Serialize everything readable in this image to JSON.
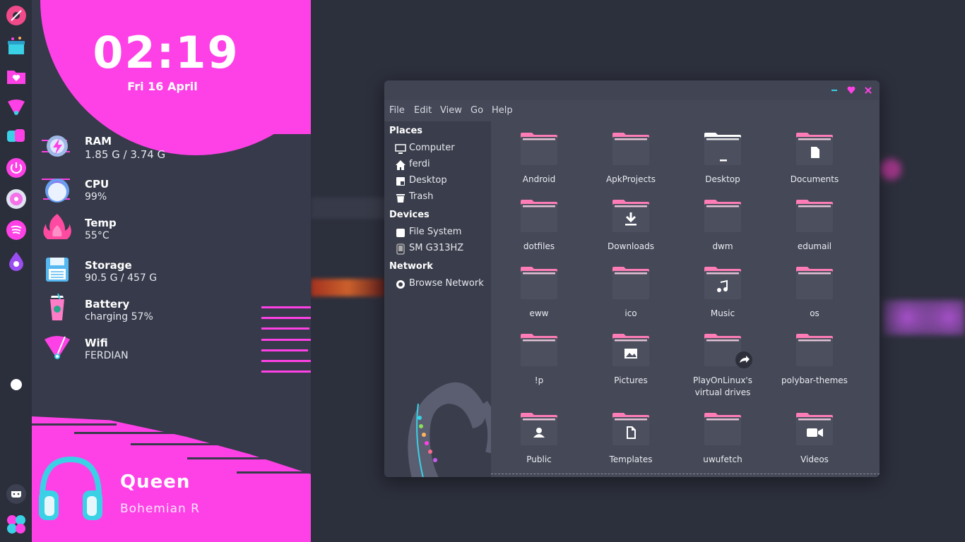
{
  "clock": {
    "time": "02:19",
    "date": "Fri 16 April"
  },
  "stats": [
    {
      "id": "ram",
      "label": "RAM",
      "value": "1.85 G / 3.74 G",
      "icon": "lightning-gear-icon"
    },
    {
      "id": "cpu",
      "label": "CPU",
      "value": "99%",
      "icon": "cpu-character-icon"
    },
    {
      "id": "temp",
      "label": "Temp",
      "value": "55°C",
      "icon": "flame-icon"
    },
    {
      "id": "storage",
      "label": "Storage",
      "value": "90.5 G / 457 G",
      "icon": "floppy-disk-icon"
    },
    {
      "id": "battery",
      "label": "Battery",
      "value": "charging 57%",
      "icon": "drink-cup-icon"
    },
    {
      "id": "wifi",
      "label": "Wifi",
      "value": "FERDIAN",
      "icon": "wifi-fan-icon"
    }
  ],
  "music": {
    "artist": "Queen",
    "title": "Bohemian R"
  },
  "file_manager": {
    "menu": [
      "File",
      "Edit",
      "View",
      "Go",
      "Help"
    ],
    "sidebar": {
      "places_heading": "Places",
      "places": [
        "Computer",
        "ferdi",
        "Desktop",
        "Trash"
      ],
      "devices_heading": "Devices",
      "devices": [
        "File System",
        "SM G313HZ"
      ],
      "network_heading": "Network",
      "network": [
        "Browse Network"
      ]
    },
    "items": [
      "Android",
      "ApkProjects",
      "Desktop",
      "Documents",
      "dotfiles",
      "Downloads",
      "dwm",
      "edumail",
      "eww",
      "ico",
      "Music",
      "os",
      "!p",
      "Pictures",
      "PlayOnLinux's virtual drives",
      "polybar-themes",
      "Public",
      "Templates",
      "uwufetch",
      "Videos"
    ]
  },
  "colors": {
    "accent": "#fe41e6",
    "panel": "#363a4a",
    "window": "#444857",
    "folder_body": "#4b4f5e",
    "folder_tab": "#ff7cb6"
  }
}
